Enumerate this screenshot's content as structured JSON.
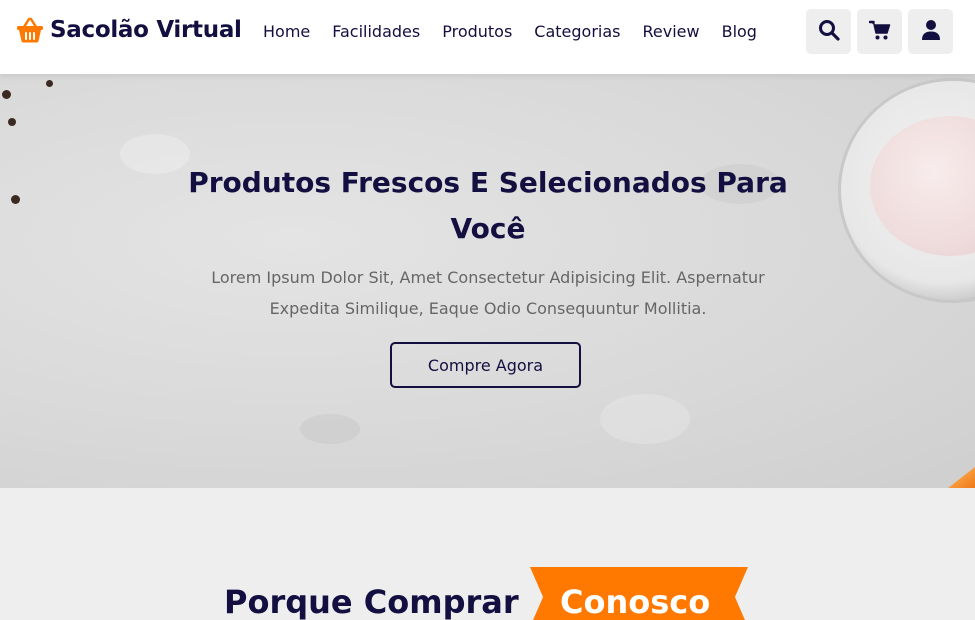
{
  "brand": {
    "name": "Sacolão Virtual",
    "accent_color": "#ff7800",
    "dark_color": "#130f40",
    "logo_icon": "shopping-basket-icon"
  },
  "nav": {
    "items": [
      "Home",
      "Facilidades",
      "Produtos",
      "Categorias",
      "Review",
      "Blog"
    ]
  },
  "header_icons": [
    "search-icon",
    "shopping-cart-icon",
    "user-icon"
  ],
  "hero": {
    "title": "Produtos Frescos E Selecionados Para Você",
    "subtitle": "Lorem Ipsum Dolor Sit, Amet Consectetur Adipisicing Elit. Aspernatur Expedita Similique, Eaque Odio Consequuntur Mollitia.",
    "button_label": "Compre Agora"
  },
  "section": {
    "title": "Porque Comprar",
    "highlight": "Conosco"
  }
}
